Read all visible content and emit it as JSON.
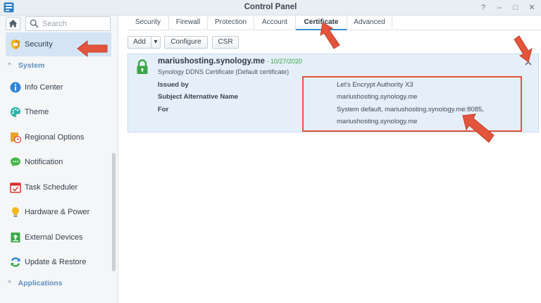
{
  "window": {
    "title": "Control Panel",
    "controls": {
      "help": "?",
      "minimize": "–",
      "maximize": "□",
      "close": "✕"
    }
  },
  "search": {
    "placeholder": "Search",
    "value": ""
  },
  "sidebar": {
    "selected": {
      "label": "Security"
    },
    "sections": [
      {
        "label": "System",
        "items": [
          {
            "label": "Info Center",
            "icon": "info-icon"
          },
          {
            "label": "Theme",
            "icon": "palette-icon"
          },
          {
            "label": "Regional Options",
            "icon": "clock-icon"
          },
          {
            "label": "Notification",
            "icon": "chat-bubble-icon"
          },
          {
            "label": "Task Scheduler",
            "icon": "calendar-icon"
          },
          {
            "label": "Hardware & Power",
            "icon": "lightbulb-icon"
          },
          {
            "label": "External Devices",
            "icon": "upload-device-icon"
          },
          {
            "label": "Update & Restore",
            "icon": "refresh-icon"
          }
        ]
      },
      {
        "label": "Applications",
        "items": []
      }
    ]
  },
  "tabs": [
    "Security",
    "Firewall",
    "Protection",
    "Account",
    "Certificate",
    "Advanced"
  ],
  "active_tab": "Certificate",
  "toolbar": {
    "add": "Add",
    "add_dropdown": "▾",
    "configure": "Configure",
    "csr": "CSR"
  },
  "certificate": {
    "name": "mariushosting.synology.me",
    "date": " - 10/27/2020",
    "description": "Synology DDNS Certificate (Default certificate)",
    "details": [
      {
        "label": "Issued by",
        "value": "Let's Encrypt Authority X3"
      },
      {
        "label": "Subject Alternative Name",
        "value": "mariushosting.synology.me"
      },
      {
        "label": "For",
        "value": "System default, mariushosting.synology.me:8085,"
      },
      {
        "label": "",
        "value": "mariushosting.synology.me"
      }
    ]
  },
  "colors": {
    "accent": "#3a8ccf",
    "selected_bg": "#d4e4f5",
    "card_bg": "#e5eff9",
    "annotation": "#e3543c",
    "valid_green": "#3ca545"
  }
}
